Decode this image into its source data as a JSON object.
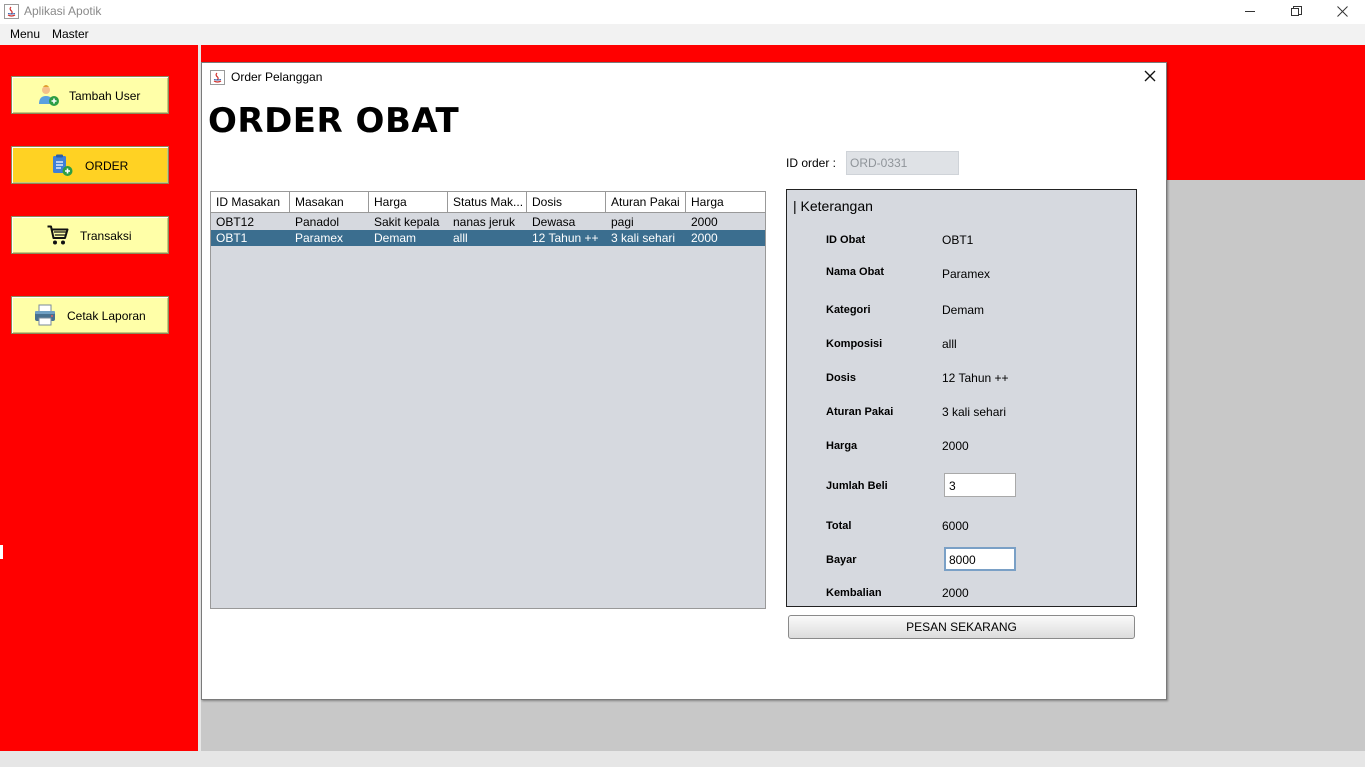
{
  "window": {
    "title": "Aplikasi Apotik",
    "app_icon": "java-icon",
    "controls": [
      "minimize-icon",
      "restore-icon",
      "close-icon"
    ]
  },
  "menubar": {
    "items": [
      "Menu",
      "Master"
    ]
  },
  "sidebar": {
    "items": [
      {
        "label": "Tambah User",
        "icon": "add-user-icon",
        "active": false
      },
      {
        "label": "ORDER",
        "icon": "order-icon",
        "active": true
      },
      {
        "label": "Transaksi",
        "icon": "cart-icon",
        "active": false
      },
      {
        "label": "Cetak Laporan",
        "icon": "printer-icon",
        "active": false
      }
    ]
  },
  "colors": {
    "sidebar": "#ff0000",
    "active_button": "#ffd223",
    "button": "#ffffa8",
    "selected_row": "#3b6e8f",
    "panel": "#d6d9df"
  },
  "order_frame": {
    "title": "Order Pelanggan",
    "heading": "ORDER OBAT",
    "id_label": "ID order :",
    "id_value": "ORD-0331",
    "table": {
      "columns": [
        "ID Masakan",
        "Masakan",
        "Harga",
        "Status Mak...",
        "Dosis",
        "Aturan Pakai",
        "Harga"
      ],
      "rows": [
        [
          "OBT12",
          "Panadol",
          "Sakit kepala",
          "nanas jeruk",
          "Dewasa",
          "pagi",
          "2000"
        ],
        [
          "OBT1",
          "Paramex",
          "Demam",
          "alll",
          "12 Tahun ++",
          "3 kali sehari",
          "2000"
        ]
      ],
      "selected_row": 1
    },
    "detail": {
      "title": "| Keterangan",
      "fields": [
        {
          "label": "ID Obat",
          "value": "OBT1"
        },
        {
          "label": "Nama Obat",
          "value": "Paramex"
        },
        {
          "label": "Kategori",
          "value": "Demam"
        },
        {
          "label": "Komposisi",
          "value": "alll"
        },
        {
          "label": "Dosis",
          "value": "12 Tahun ++"
        },
        {
          "label": "Aturan Pakai",
          "value": "3 kali sehari"
        },
        {
          "label": "Harga",
          "value": "2000"
        },
        {
          "label": "Jumlah Beli",
          "value": "3"
        },
        {
          "label": "Total",
          "value": "6000"
        },
        {
          "label": "Bayar",
          "value": "8000"
        },
        {
          "label": "Kembalian",
          "value": "2000"
        }
      ]
    },
    "order_button": "PESAN SEKARANG"
  }
}
